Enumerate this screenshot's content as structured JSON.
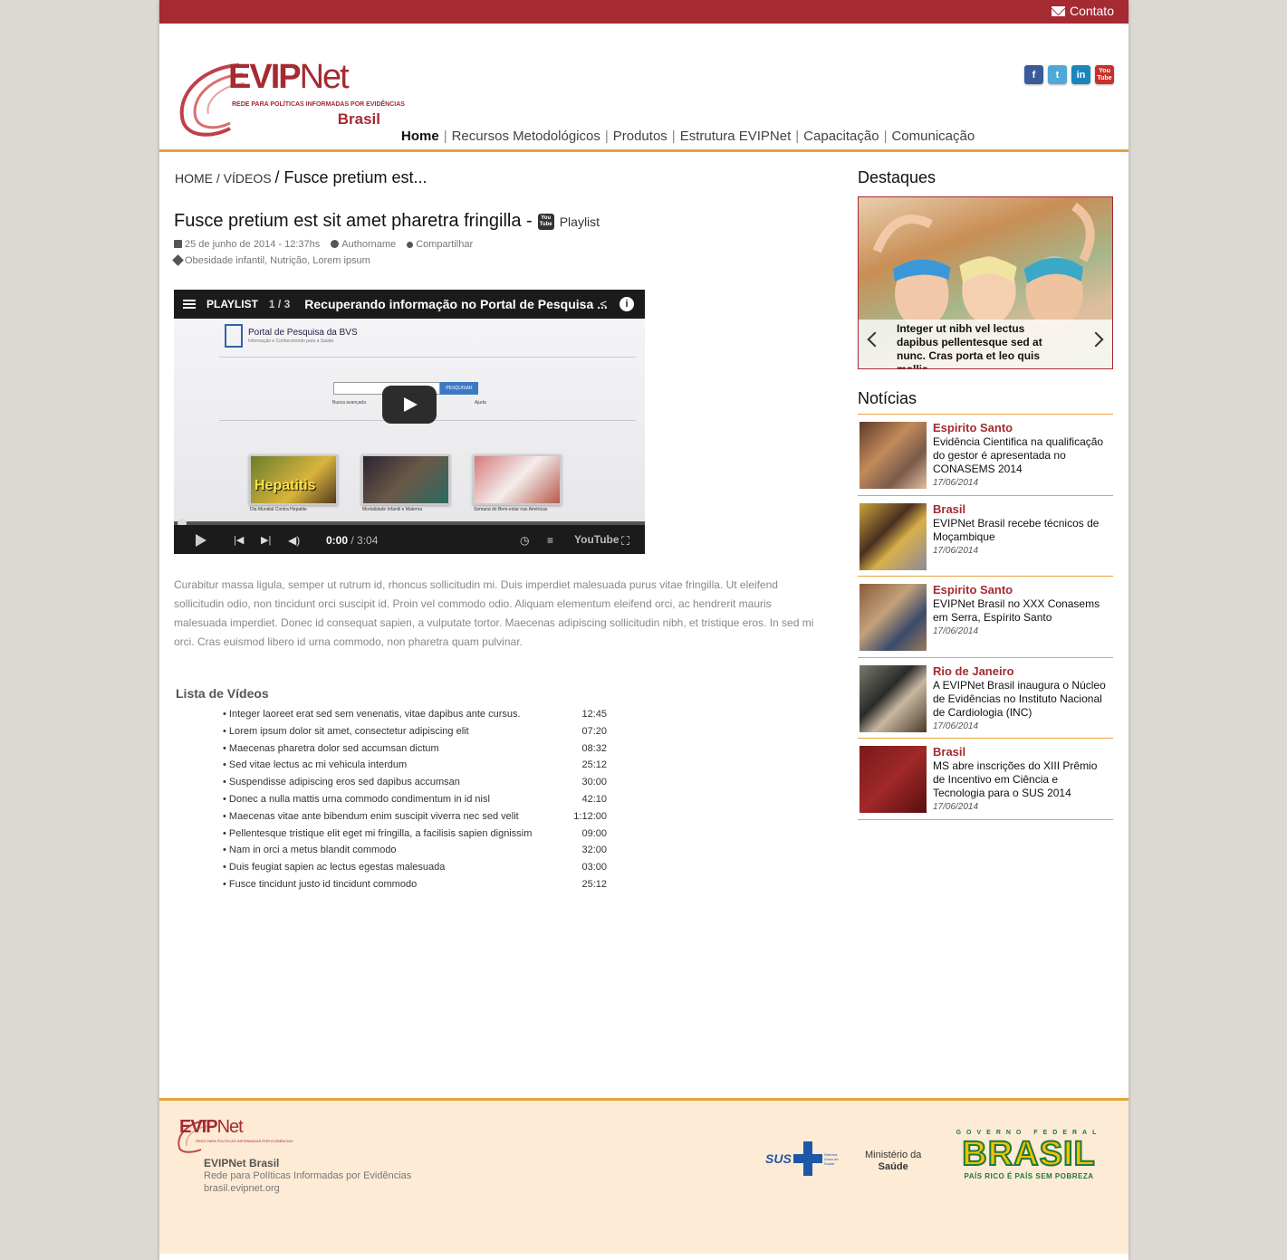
{
  "topbar": {
    "contato": "Contato"
  },
  "logo": {
    "name_bold": "EVIP",
    "name_net": "Net",
    "tagline": "REDE PARA POLÍTICAS INFORMADAS POR EVIDÊNCIAS",
    "country": "Brasil"
  },
  "nav": [
    "Home",
    "Recursos Metodológicos",
    "Produtos",
    "Estrutura EVIPNet",
    "Capacitação",
    "Comunicação"
  ],
  "social": {
    "facebook": "f",
    "twitter": "t",
    "linkedin": "in",
    "youtube": "You Tube"
  },
  "breadcrumb": {
    "home": "HOME",
    "videos": "VÍDEOS",
    "current": "Fusce pretium est..."
  },
  "article": {
    "title": "Fusce pretium est sit amet pharetra fringilla -",
    "playlist_label": "Playlist",
    "youtube_badge": "You Tube",
    "date": "25 de junho de 2014 - 12:37hs",
    "author": "Authorname",
    "share": "Compartilhar",
    "tags": "Obesidade infantil, Nutrição, Lorem ipsum",
    "description": "Curabitur massa ligula, semper ut rutrum id, rhoncus sollicitudin mi. Duis imperdiet malesuada purus vitae fringilla. Ut eleifend sollicitudin odio, non tincidunt orci suscipit id. Proin vel commodo odio. Aliquam elementum eleifend orci, ac hendrerit mauris malesuada imperdiet. Donec id consequat sapien, a vulputate tortor. Maecenas adipiscing sollicitudin nibh, et tristique eros. In sed mi orci. Cras euismod libero id urna commodo, non pharetra quam pulvinar."
  },
  "player": {
    "playlist": "PLAYLIST",
    "count": "1 / 3",
    "video_title": "Recuperando informação no Portal de Pesquisa ...",
    "info": "i",
    "bvs_title": "Portal de Pesquisa da BVS",
    "bvs_sub": "Informação e Conhecimento para a Saúde",
    "search_button": "PESQUISAR",
    "search_opts": "Busca avançada",
    "help": "Ajuda",
    "thumb1_label": "Hepatitis",
    "thumb1_caption": "Dia Mundial Contra Hepatite",
    "thumb2_caption": "Mortalidade Infantil e Materna",
    "thumb3_caption": "Semana do Bem-estar nas Américas",
    "time_current": "0:00",
    "time_total": "/ 3:04",
    "yt_logo": "YouTube"
  },
  "video_list": {
    "title": "Lista de Vídeos",
    "items": [
      {
        "label": "Integer laoreet erat sed sem venenatis, vitae dapibus ante cursus.",
        "duration": "12:45"
      },
      {
        "label": "Lorem ipsum dolor sit amet, consectetur adipiscing elit",
        "duration": "07:20"
      },
      {
        "label": "Maecenas pharetra dolor sed accumsan dictum",
        "duration": "08:32"
      },
      {
        "label": "Sed vitae lectus ac mi vehicula interdum",
        "duration": "25:12"
      },
      {
        "label": "Suspendisse adipiscing eros sed dapibus accumsan",
        "duration": "30:00"
      },
      {
        "label": "Donec a nulla mattis urna commodo condimentum in id nisl",
        "duration": "42:10"
      },
      {
        "label": "Maecenas vitae ante bibendum enim suscipit viverra nec sed velit",
        "duration": "1:12:00"
      },
      {
        "label": "Pellentesque tristique elit eget mi fringilla, a facilisis sapien dignissim",
        "duration": "09:00"
      },
      {
        "label": "Nam in orci a metus blandit commodo",
        "duration": "32:00"
      },
      {
        "label": "Duis feugiat sapien ac lectus egestas malesuada",
        "duration": "03:00"
      },
      {
        "label": "Fusce tincidunt justo id tincidunt commodo",
        "duration": "25:12"
      }
    ]
  },
  "sidebar": {
    "destaques_title": "Destaques",
    "slide_caption": "Integer ut nibh vel lectus dapibus pellentesque sed at nunc. Cras porta et leo quis mollis",
    "noticias_title": "Notícias",
    "news": [
      {
        "category": "Espirito Santo",
        "text": "Evidência Cientifica na qualificação do gestor é apresentada no CONASEMS 2014",
        "date": "17/06/2014"
      },
      {
        "category": "Brasil",
        "text": "EVIPNet Brasil recebe técnicos de Moçambique",
        "date": "17/06/2014"
      },
      {
        "category": "Espirito Santo",
        "text": "EVIPNet Brasil no XXX Conasems em Serra, Espírito Santo",
        "date": "17/06/2014"
      },
      {
        "category": "Rio de Janeiro",
        "text": "A EVIPNet Brasil inaugura o Núcleo de Evidências no Instituto Nacional de Cardiologia (INC)",
        "date": "17/06/2014"
      },
      {
        "category": "Brasil",
        "text": "MS abre inscrições do XIII Prêmio de Incentivo em Ciência e Tecnologia para o SUS 2014",
        "date": "17/06/2014"
      }
    ]
  },
  "footer": {
    "logo_bold": "EVIP",
    "logo_net": "Net",
    "logo_tagline": "REDE PARA POLÍTICAS INFORMADAS POR EVIDÊNCIAS",
    "name": "EVIPNet Brasil",
    "line2": "Rede para Políticas Informadas por Evidências",
    "line3": "brasil.evipnet.org",
    "sus": "SUS",
    "sus_sub": "Sistema Único de Saúde",
    "ministerio_l1": "Ministério da",
    "ministerio_l2": "Saúde",
    "gov_top": "GOVERNO FEDERAL",
    "gov_main": "BRASIL",
    "gov_bottom": "PAÍS RICO É PAÍS SEM POBREZA"
  }
}
